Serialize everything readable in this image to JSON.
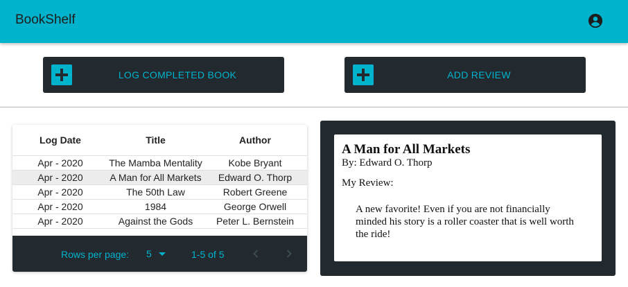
{
  "app": {
    "title": "BookShelf",
    "accent_color": "#00b3cc",
    "dark_color": "#222a30"
  },
  "header": {
    "account_icon": "account-circle-icon"
  },
  "actions": {
    "log_label": "LOG COMPLETED BOOK",
    "review_label": "ADD REVIEW",
    "icon": "plus-box-icon"
  },
  "table": {
    "columns": [
      "Log Date",
      "Title",
      "Author"
    ],
    "rows": [
      {
        "date": "Apr - 2020",
        "title": "The Mamba Mentality",
        "author": "Kobe Bryant",
        "selected": false
      },
      {
        "date": "Apr - 2020",
        "title": "A Man for All Markets",
        "author": "Edward O. Thorp",
        "selected": true
      },
      {
        "date": "Apr - 2020",
        "title": "The 50th Law",
        "author": "Robert Greene",
        "selected": false
      },
      {
        "date": "Apr - 2020",
        "title": "1984",
        "author": "George Orwell",
        "selected": false
      },
      {
        "date": "Apr - 2020",
        "title": "Against the Gods",
        "author": "Peter L. Bernstein",
        "selected": false
      }
    ],
    "pagination": {
      "rows_per_page_label": "Rows per page:",
      "rows_per_page_value": "5",
      "range": "1-5 of 5",
      "prev_icon": "chevron-left-icon",
      "next_icon": "chevron-right-icon"
    }
  },
  "review": {
    "title": "A Man for All Markets",
    "author": "By: Edward O. Thorp",
    "heading": "My Review:",
    "body": "A new favorite! Even if you are not financially minded his story is a roller coaster that is well worth the ride!"
  }
}
